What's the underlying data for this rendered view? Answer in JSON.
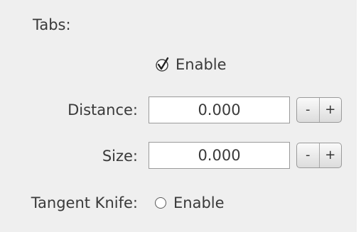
{
  "section": {
    "title": "Tabs:"
  },
  "enable_tabs": {
    "label": "Enable",
    "checked": true,
    "icon": "checkmark-icon"
  },
  "distance": {
    "label": "Distance:",
    "value": "0.000",
    "decrement": "-",
    "increment": "+"
  },
  "size": {
    "label": "Size:",
    "value": "0.000",
    "decrement": "-",
    "increment": "+"
  },
  "tangent_knife": {
    "label": "Tangent Knife:",
    "option_label": "Enable",
    "selected": false,
    "icon": "radio-icon"
  }
}
